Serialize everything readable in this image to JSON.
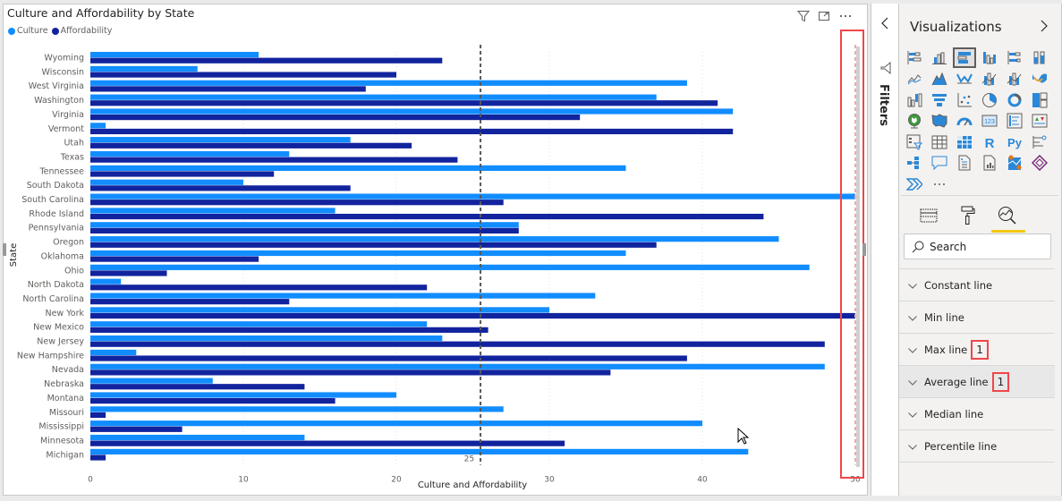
{
  "visual": {
    "title": "Culture and Affordability by State",
    "header_icons": [
      "filter-icon",
      "focus-mode-icon",
      "more-options-icon"
    ]
  },
  "chart_data": {
    "type": "bar",
    "orientation": "horizontal",
    "title": "Culture and Affordability by State",
    "xlabel": "Culture and Affordability",
    "ylabel": "State",
    "xlim": [
      0,
      50
    ],
    "xticks": [
      0,
      10,
      20,
      30,
      40,
      50
    ],
    "grid": true,
    "legend_position": "top-left",
    "categories": [
      "Wyoming",
      "Wisconsin",
      "West Virginia",
      "Washington",
      "Virginia",
      "Vermont",
      "Utah",
      "Texas",
      "Tennessee",
      "South Dakota",
      "South Carolina",
      "Rhode Island",
      "Pennsylvania",
      "Oregon",
      "Oklahoma",
      "Ohio",
      "North Dakota",
      "North Carolina",
      "New York",
      "New Mexico",
      "New Jersey",
      "New Hampshire",
      "Nevada",
      "Nebraska",
      "Montana",
      "Missouri",
      "Mississippi",
      "Minnesota",
      "Michigan"
    ],
    "series": [
      {
        "name": "Culture",
        "color": "#118dff",
        "values": [
          11,
          7,
          39,
          37,
          42,
          1,
          17,
          13,
          35,
          10,
          50,
          16,
          28,
          45,
          35,
          47,
          2,
          33,
          30,
          22,
          23,
          3,
          48,
          8,
          20,
          27,
          40,
          14,
          43
        ]
      },
      {
        "name": "Affordability",
        "color": "#12239e",
        "values": [
          23,
          20,
          18,
          41,
          32,
          42,
          21,
          24,
          12,
          17,
          27,
          44,
          28,
          37,
          11,
          5,
          22,
          13,
          50,
          26,
          48,
          39,
          34,
          14,
          16,
          1,
          6,
          31,
          1
        ]
      }
    ],
    "reference_lines": [
      {
        "type": "average",
        "value": 25.5,
        "label": "25",
        "color": "#595959",
        "style": "dashed"
      },
      {
        "type": "max",
        "value": 50,
        "label": "50",
        "color": "#f4a7ab",
        "style": "dashed"
      }
    ]
  },
  "filters_pane": {
    "label": "Filters"
  },
  "viz_pane": {
    "title": "Visualizations",
    "search_placeholder": "Search",
    "analytics_items": [
      {
        "label": "Constant line",
        "count": ""
      },
      {
        "label": "Min line",
        "count": ""
      },
      {
        "label": "Max line",
        "count": "1"
      },
      {
        "label": "Average line",
        "count": "1"
      },
      {
        "label": "Median line",
        "count": ""
      },
      {
        "label": "Percentile line",
        "count": ""
      }
    ],
    "tabs": [
      "fields-tab",
      "format-tab",
      "analytics-tab"
    ],
    "active_tab": "analytics-tab"
  },
  "colors": {
    "culture": "#118dff",
    "affordability": "#12239e",
    "highlight": "#f0464b",
    "accent_tab": "#f2c811"
  }
}
